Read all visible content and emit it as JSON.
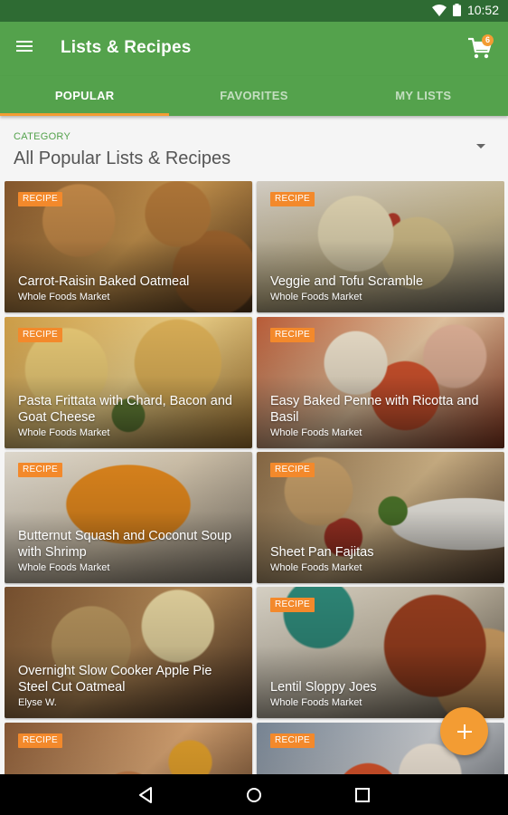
{
  "status_bar": {
    "time": "10:52"
  },
  "app_bar": {
    "title": "Lists & Recipes",
    "cart_count": "6"
  },
  "tabs": [
    {
      "label": "POPULAR",
      "active": true
    },
    {
      "label": "FAVORITES",
      "active": false
    },
    {
      "label": "MY LISTS",
      "active": false
    }
  ],
  "category": {
    "label": "CATEGORY",
    "value": "All Popular Lists & Recipes"
  },
  "cards": [
    {
      "badge": "RECIPE",
      "title": "Carrot-Raisin Baked Oatmeal",
      "source": "Whole Foods Market"
    },
    {
      "badge": "RECIPE",
      "title": "Veggie and Tofu Scramble",
      "source": "Whole Foods Market"
    },
    {
      "badge": "RECIPE",
      "title": "Pasta Frittata with Chard, Bacon and Goat Cheese",
      "source": "Whole Foods Market"
    },
    {
      "badge": "RECIPE",
      "title": "Easy Baked Penne with Ricotta and Basil",
      "source": "Whole Foods Market"
    },
    {
      "badge": "RECIPE",
      "title": "Butternut Squash and Coconut Soup with Shrimp",
      "source": "Whole Foods Market"
    },
    {
      "badge": "RECIPE",
      "title": "Sheet Pan Fajitas",
      "source": "Whole Foods Market"
    },
    {
      "badge": "",
      "title": "Overnight Slow Cooker Apple Pie Steel Cut Oatmeal",
      "source": "Elyse W."
    },
    {
      "badge": "RECIPE",
      "title": "Lentil Sloppy Joes",
      "source": "Whole Foods Market"
    },
    {
      "badge": "RECIPE",
      "title": "",
      "source": ""
    },
    {
      "badge": "RECIPE",
      "title": "",
      "source": ""
    }
  ],
  "colors": {
    "toolbar": "#54a24c",
    "status_bar": "#2e6b33",
    "accent": "#f39c33",
    "badge": "#f3892b"
  },
  "icons": {
    "menu": "menu-icon",
    "cart": "cart-icon",
    "fab": "add-icon",
    "dropdown": "chevron-down-icon"
  }
}
